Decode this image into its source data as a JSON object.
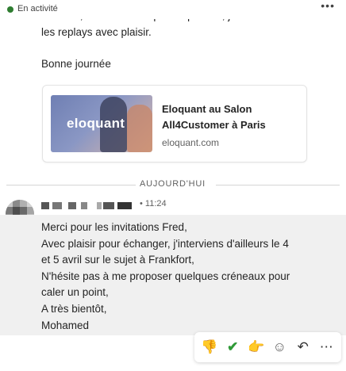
{
  "status": {
    "text": "En activité",
    "more": "•••"
  },
  "prev_message": {
    "line1": "Bien sûr, si vous n'êtes pas disponible, je vous enverrai",
    "line2": "les replays avec plaisir.",
    "greeting": "Bonne journée"
  },
  "link_card": {
    "logo": "eloquant",
    "title": "Eloquant au Salon All4Customer à Paris",
    "domain": "eloquant.com"
  },
  "divider": {
    "label": "AUJOURD'HUI"
  },
  "message": {
    "time": "• 11:24",
    "lines": [
      "Merci pour les invitations Fred,",
      "Avec plaisir pour échanger, j'interviens d'ailleurs le 4",
      "et 5 avril sur le sujet à Frankfort,",
      "N'hésite pas à me proposer quelques créneaux pour",
      "caler un point,",
      "A très bientôt,",
      "Mohamed"
    ]
  },
  "reactions": {
    "icons": [
      "thumbs-down-icon",
      "check-icon",
      "pointing-icon",
      "smiley-add-icon",
      "reply-icon",
      "more-icon"
    ],
    "thumb": "👎",
    "check": "✔",
    "point": "👉",
    "smile": "☺",
    "reply": "↶",
    "more": "⋯"
  }
}
